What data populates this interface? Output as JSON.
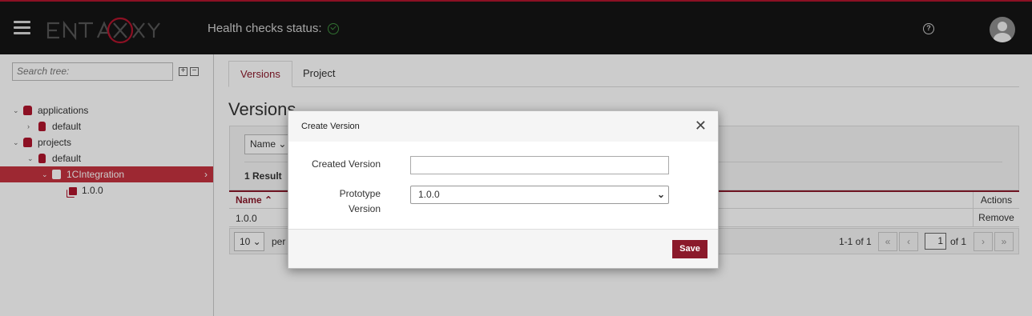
{
  "header": {
    "logo_text": "ENTAXY",
    "health_label": "Health checks status:",
    "health_icon": "check-circle-icon",
    "help_icon": "question-circle-icon",
    "avatar_icon": "user-icon",
    "accent": "#b0152c"
  },
  "sidebar": {
    "search_placeholder": "Search tree:",
    "expand_all": "+",
    "collapse_all": "−",
    "tree": [
      {
        "label": "applications",
        "toggle": "⌄",
        "icon": "applications-icon"
      },
      {
        "label": "default",
        "toggle": "›",
        "icon": "database-icon"
      },
      {
        "label": "projects",
        "toggle": "⌄",
        "icon": "projects-icon"
      },
      {
        "label": "default",
        "toggle": "⌄",
        "icon": "database-icon"
      },
      {
        "label": "1CIntegration",
        "toggle": "⌄",
        "icon": "project-icon",
        "selected": true,
        "chevron": "›"
      },
      {
        "label": "1.0.0",
        "toggle": "",
        "icon": "versions-icon"
      }
    ]
  },
  "main": {
    "tabs": [
      {
        "label": "Versions",
        "active": true
      },
      {
        "label": "Project",
        "active": false
      }
    ],
    "title": "Versions",
    "filter_label": "Name ⌄",
    "result_count": "1 Result",
    "table": {
      "col_name": "Name ⌃",
      "col_actions": "Actions",
      "rows": [
        {
          "name": "1.0.0",
          "action": "Remove"
        }
      ]
    },
    "pager": {
      "per_page_value": "10 ⌄",
      "per_page_label": "per page",
      "range": "1-1 of 1",
      "first": "«",
      "prev": "‹",
      "page": "1",
      "of_pages": "of 1",
      "next": "›",
      "last": "»"
    }
  },
  "modal": {
    "title": "Create Version",
    "close": "✕",
    "created_version_label": "Created Version",
    "created_version_value": "",
    "prototype_label_1": "Prototype",
    "prototype_label_2": "Version",
    "prototype_value": "1.0.0",
    "prototype_chevron": "⌄",
    "save_label": "Save"
  }
}
